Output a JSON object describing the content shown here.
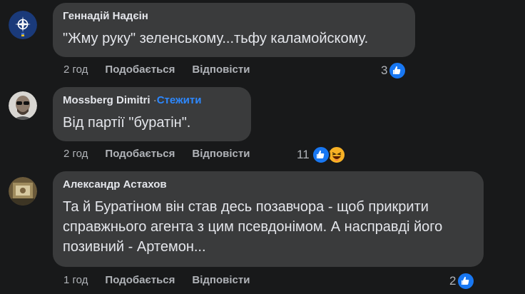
{
  "comments": [
    {
      "author": "Геннадій Надєін",
      "follow": "",
      "text": "\"Жму руку\" зеленському...тьфу каламойскому.",
      "time": "2 год",
      "like_label": "Подобається",
      "reply_label": "Відповісти",
      "reaction_count": "3",
      "reactions": [
        "like-icon"
      ]
    },
    {
      "author": "Mossberg Dimitri",
      "dot": "·",
      "follow": "Стежити",
      "text": "Від партії \"буратін\".",
      "time": "2 год",
      "like_label": "Подобається",
      "reply_label": "Відповісти",
      "reaction_count": "11",
      "reactions": [
        "like-icon",
        "haha-icon"
      ]
    },
    {
      "author": "Александр Астахов",
      "follow": "",
      "text": "Та й Буратіном він став десь позавчора - щоб прикрити справжнього агента з цим псевдонімом. А насправді його позивний - Артемон...",
      "time": "1 год",
      "like_label": "Подобається",
      "reply_label": "Відповісти",
      "reaction_count": "2",
      "reactions": [
        "like-icon"
      ]
    }
  ],
  "colors": {
    "background": "#18191a",
    "bubble": "#3a3b3c",
    "text": "#e4e6eb",
    "secondary": "#b0b3b8",
    "accent": "#2d88ff",
    "like": "#1877f2"
  }
}
